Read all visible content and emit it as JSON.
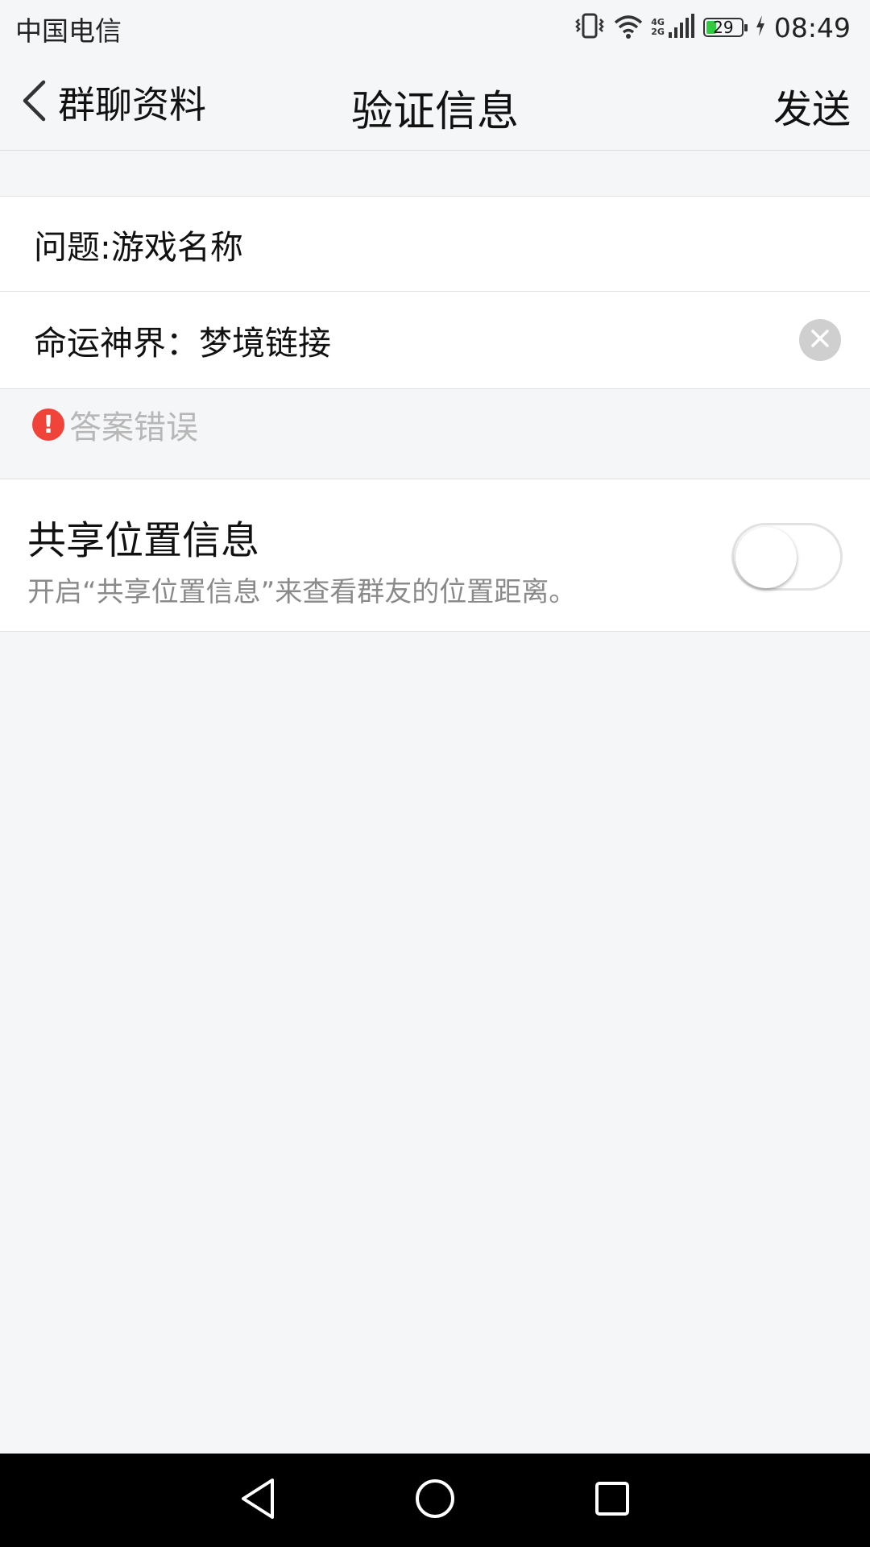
{
  "status_bar": {
    "carrier": "中国电信",
    "network_label_top": "4G",
    "network_label_bottom": "2G",
    "battery": "29",
    "battery_level": 0.29,
    "time": "08:49"
  },
  "nav": {
    "back_label": "群聊资料",
    "title": "验证信息",
    "send_label": "发送"
  },
  "form": {
    "question": "问题:游戏名称",
    "answer_value": "命运神界：梦境链接"
  },
  "error": {
    "icon": "!",
    "message": "答案错误"
  },
  "location": {
    "title": "共享位置信息",
    "description": "开启“共享位置信息”来查看群友的位置距离。",
    "enabled": false
  },
  "colors": {
    "error_red": "#f0433a",
    "battery_green": "#2ecc40"
  },
  "icons": {
    "vibrate": "vibrate-icon",
    "wifi": "wifi-icon",
    "signal": "signal-icon",
    "battery": "battery-icon",
    "charging": "charging-icon",
    "back": "chevron-left-icon",
    "clear": "close-icon",
    "sys_back": "triangle-back-icon",
    "sys_home": "circle-home-icon",
    "sys_recent": "square-recent-icon"
  }
}
